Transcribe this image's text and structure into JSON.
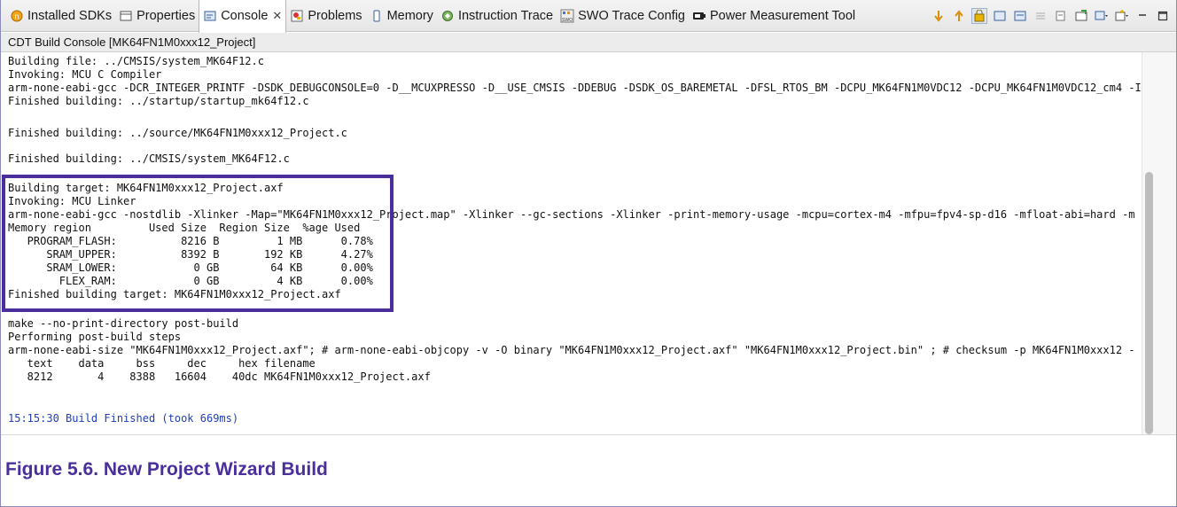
{
  "tabs": [
    {
      "label": "Installed SDKs",
      "icon": "sdk-icon",
      "active": false
    },
    {
      "label": "Properties",
      "icon": "properties-icon",
      "active": false
    },
    {
      "label": "Console",
      "icon": "console-icon",
      "active": true,
      "close": "✕"
    },
    {
      "label": "Problems",
      "icon": "problems-icon",
      "active": false
    },
    {
      "label": "Memory",
      "icon": "memory-icon",
      "active": false
    },
    {
      "label": "Instruction Trace",
      "icon": "trace-icon",
      "active": false
    },
    {
      "label": "SWO Trace Config",
      "icon": "swo-icon",
      "active": false
    },
    {
      "label": "Power Measurement Tool",
      "icon": "power-icon",
      "active": false
    }
  ],
  "toolbar_icons": [
    "scroll-down-icon",
    "scroll-up-icon",
    "scroll-lock-icon",
    "clear-console-icon",
    "word-wrap-icon",
    "show-console-icon",
    "pin-console-icon",
    "open-console-icon",
    "display-console-icon",
    "new-console-icon",
    "minimize-icon",
    "maximize-icon"
  ],
  "console": {
    "title": "CDT Build Console [MK64FN1M0xxx12_Project]",
    "lines": [
      "Building file: ../CMSIS/system_MK64F12.c",
      "Invoking: MCU C Compiler",
      "arm-none-eabi-gcc -DCR_INTEGER_PRINTF -DSDK_DEBUGCONSOLE=0 -D__MCUXPRESSO -D__USE_CMSIS -DDEBUG -DSDK_OS_BAREMETAL -DFSL_RTOS_BM -DCPU_MK64FN1M0VDC12 -DCPU_MK64FN1M0VDC12_cm4 -I",
      "Finished building: ../startup/startup_mk64f12.c",
      "",
      "Finished building: ../source/MK64FN1M0xxx12_Project.c",
      "",
      "Finished building: ../CMSIS/system_MK64F12.c",
      "",
      "Building target: MK64FN1M0xxx12_Project.axf",
      "Invoking: MCU Linker",
      "arm-none-eabi-gcc -nostdlib -Xlinker -Map=\"MK64FN1M0xxx12_Project.map\" -Xlinker --gc-sections -Xlinker -print-memory-usage -mcpu=cortex-m4 -mfpu=fpv4-sp-d16 -mfloat-abi=hard -m",
      "Memory region         Used Size  Region Size  %age Used",
      "   PROGRAM_FLASH:          8216 B         1 MB      0.78%",
      "      SRAM_UPPER:          8392 B       192 KB      4.27%",
      "      SRAM_LOWER:            0 GB        64 KB      0.00%",
      "        FLEX_RAM:            0 GB         4 KB      0.00%",
      "Finished building target: MK64FN1M0xxx12_Project.axf",
      "",
      "make --no-print-directory post-build",
      "Performing post-build steps",
      "arm-none-eabi-size \"MK64FN1M0xxx12_Project.axf\"; # arm-none-eabi-objcopy -v -O binary \"MK64FN1M0xxx12_Project.axf\" \"MK64FN1M0xxx12_Project.bin\" ; # checksum -p MK64FN1M0xxx12 -",
      "   text    data     bss     dec     hex filename",
      "   8212       4    8388   16604    40dc MK64FN1M0xxx12_Project.axf",
      "",
      "",
      "15:15:30 Build Finished (took 669ms)"
    ]
  },
  "caption": "Figure 5.6. New Project Wizard Build",
  "colors": {
    "accent": "#4a2f9c",
    "status_text": "#1e3fb8"
  }
}
